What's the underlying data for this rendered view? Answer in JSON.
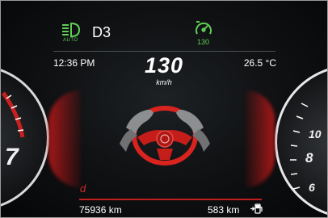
{
  "status": {
    "gear": "D3",
    "headlight_mode": "AUTO",
    "cruise_speed": "130"
  },
  "info": {
    "time": "12:36 PM",
    "outside_temp": "26.5 °C"
  },
  "speedometer": {
    "speed": "130",
    "unit": "km/h"
  },
  "drive_mode": "d",
  "trip": {
    "odometer": "75936 km",
    "range": "583 km"
  },
  "gauges": {
    "left_visible_numeral": "7",
    "right_numerals": [
      "10",
      "8",
      "6"
    ]
  },
  "colors": {
    "accent_green": "#5fcf55",
    "accent_red": "#d62a2a",
    "text": "#ffffff"
  },
  "icons": [
    "headlight-auto-icon",
    "cruise-control-icon",
    "steering-wheel-icon",
    "fuel-pump-icon"
  ]
}
